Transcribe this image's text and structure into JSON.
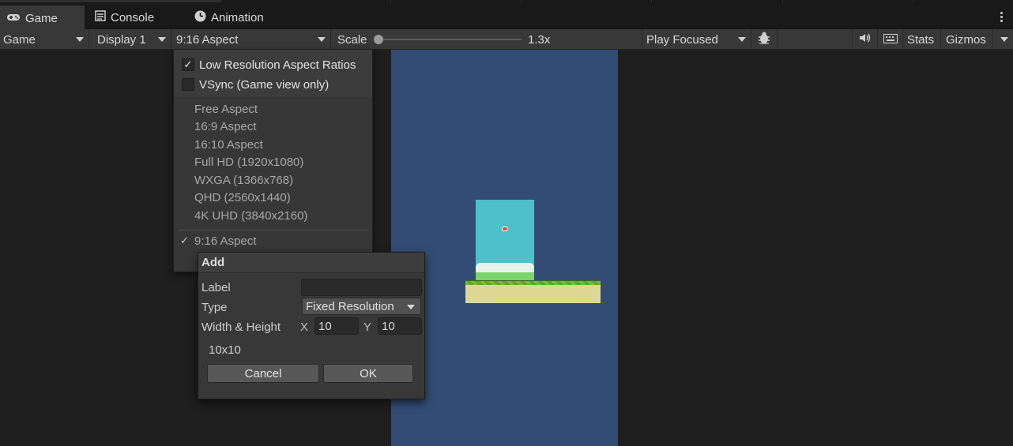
{
  "tabs": [
    {
      "label": "Game",
      "icon": "gamepad-icon",
      "active": true
    },
    {
      "label": "Console",
      "icon": "console-icon",
      "active": false
    },
    {
      "label": "Animation",
      "icon": "animation-clock-icon",
      "active": false
    }
  ],
  "toolbar": {
    "view_mode": "Game",
    "display": "Display 1",
    "aspect": "9:16 Aspect",
    "scale_label": "Scale",
    "scale_value": "1.3x",
    "play_mode": "Play Focused",
    "stats": "Stats",
    "gizmos": "Gizmos"
  },
  "aspect_menu": {
    "options": [
      {
        "label": "Low Resolution Aspect Ratios",
        "checked": true
      },
      {
        "label": "VSync (Game view only)",
        "checked": false
      }
    ],
    "items": [
      "Free Aspect",
      "16:9 Aspect",
      "16:10 Aspect",
      "Full HD (1920x1080)",
      "WXGA (1366x768)",
      "QHD (2560x1440)",
      "4K UHD (3840x2160)"
    ],
    "selected": "9:16 Aspect"
  },
  "add_dialog": {
    "title": "Add",
    "label_label": "Label",
    "label_value": "",
    "type_label": "Type",
    "type_value": "Fixed Resolution",
    "size_label": "Width & Height",
    "x_axis": "X",
    "x_value": "10",
    "y_axis": "Y",
    "y_value": "10",
    "preview": "10x10",
    "cancel": "Cancel",
    "ok": "OK"
  },
  "colors": {
    "game_frame": "#324c74",
    "sky": "#4ec0ca",
    "ground": "#ded895"
  }
}
